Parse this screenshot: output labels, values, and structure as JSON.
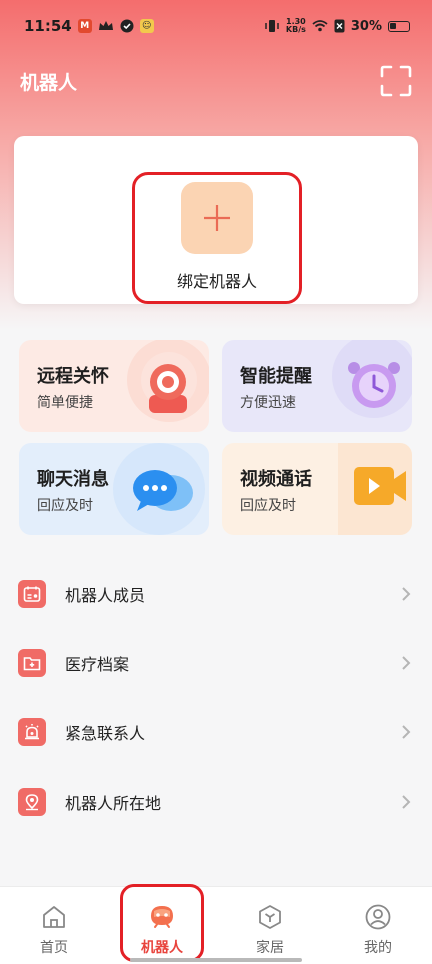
{
  "status_bar": {
    "time": "11:54",
    "net_speed_value": "1.30",
    "net_speed_unit": "KB/s",
    "battery": "30%"
  },
  "header": {
    "title": "机器人",
    "scan_icon": "scan-icon"
  },
  "bind_card": {
    "label": "绑定机器人",
    "icon": "plus-icon"
  },
  "features": [
    {
      "title": "远程关怀",
      "subtitle": "简单便捷",
      "icon": "camera-icon"
    },
    {
      "title": "智能提醒",
      "subtitle": "方便迅速",
      "icon": "alarm-clock-icon"
    },
    {
      "title": "聊天消息",
      "subtitle": "回应及时",
      "icon": "chat-bubble-icon"
    },
    {
      "title": "视频通话",
      "subtitle": "回应及时",
      "icon": "video-call-icon"
    }
  ],
  "menu": [
    {
      "label": "机器人成员",
      "icon": "members-calendar-icon"
    },
    {
      "label": "医疗档案",
      "icon": "medical-folder-icon"
    },
    {
      "label": "紧急联系人",
      "icon": "alarm-siren-icon"
    },
    {
      "label": "机器人所在地",
      "icon": "location-pin-icon"
    }
  ],
  "tabs": [
    {
      "label": "首页",
      "icon": "home-icon"
    },
    {
      "label": "机器人",
      "icon": "robot-icon",
      "active": true
    },
    {
      "label": "家居",
      "icon": "smart-home-icon"
    },
    {
      "label": "我的",
      "icon": "profile-icon"
    }
  ],
  "colors": {
    "accent": "#e8443d",
    "header_gradient_top": "#f46d6d",
    "menu_icon_bg": "#f06b66",
    "annotation_red": "#e32026"
  }
}
